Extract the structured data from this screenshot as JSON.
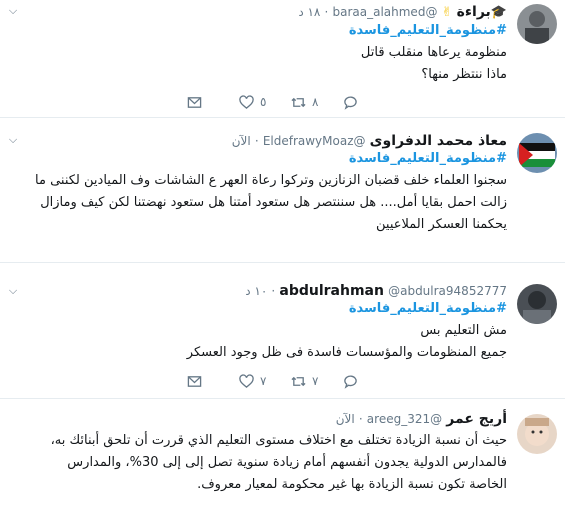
{
  "tweets": [
    {
      "name": "براءة",
      "emoji_graduation": "🎓",
      "emoji_victory": "✌",
      "handle": "@baraa_alahmed",
      "dot": "·",
      "time": "١٨ د",
      "hashtag": "#منظومة_التعليم_فاسدة",
      "lines": [
        "منظومة يرعاها منقلب قاتل",
        "ماذا ننتظر منها؟"
      ],
      "replies": "",
      "retweets": "٨",
      "likes": "٥"
    },
    {
      "name": "معاذ محمد الدفراوى",
      "handle": "@EldefrawyMoaz",
      "dot": "·",
      "time": "الآن",
      "hashtag": "#منظومة_التعليم_فاسدة",
      "lines": [
        "سجنوا العلماء خلف قضبان الزنازين وتركوا رعاة العهر ع الشاشات وف الميادين لكننى ما",
        "زالت احمل بقايا أمل.... هل سننتصر  هل ستعود أمتنا هل ستعود نهضتنا لكن كيف ومازال",
        "يحكمنا العسكر الملاعيين"
      ]
    },
    {
      "name": "abdulrahman",
      "handle": "@abdulra94852777",
      "dot": "·",
      "time": "١٠ د",
      "hashtag": "#منظومة_التعليم_فاسدة",
      "lines": [
        "مش التعليم بس",
        "جميع المنظومات والمؤسسات فاسدة فى ظل وجود العسكر"
      ],
      "replies": "",
      "retweets": "٧",
      "likes": "٧"
    },
    {
      "name": "أريج عمر",
      "handle": "@areeg_321",
      "dot": "·",
      "time": "الآن",
      "lines": [
        "حيث أن نسبة الزيادة تختلف مع اختلاف مستوى التعليم الذي قررت أن تلحق أبنائك به،",
        "فالمدارس الدولية يجدون أنفسهم أمام زيادة سنوية تصل إلى إلى 30%، والمدارس",
        "الخاصة تكون نسبة الزيادة بها غير محكومة لمعيار معروف."
      ]
    }
  ],
  "colors": {
    "link": "#1b95e0",
    "muted": "#657786",
    "border": "#e6ecf0"
  },
  "icons": [
    "reply-icon",
    "retweet-icon",
    "like-icon",
    "dm-icon",
    "caret-down-icon"
  ]
}
